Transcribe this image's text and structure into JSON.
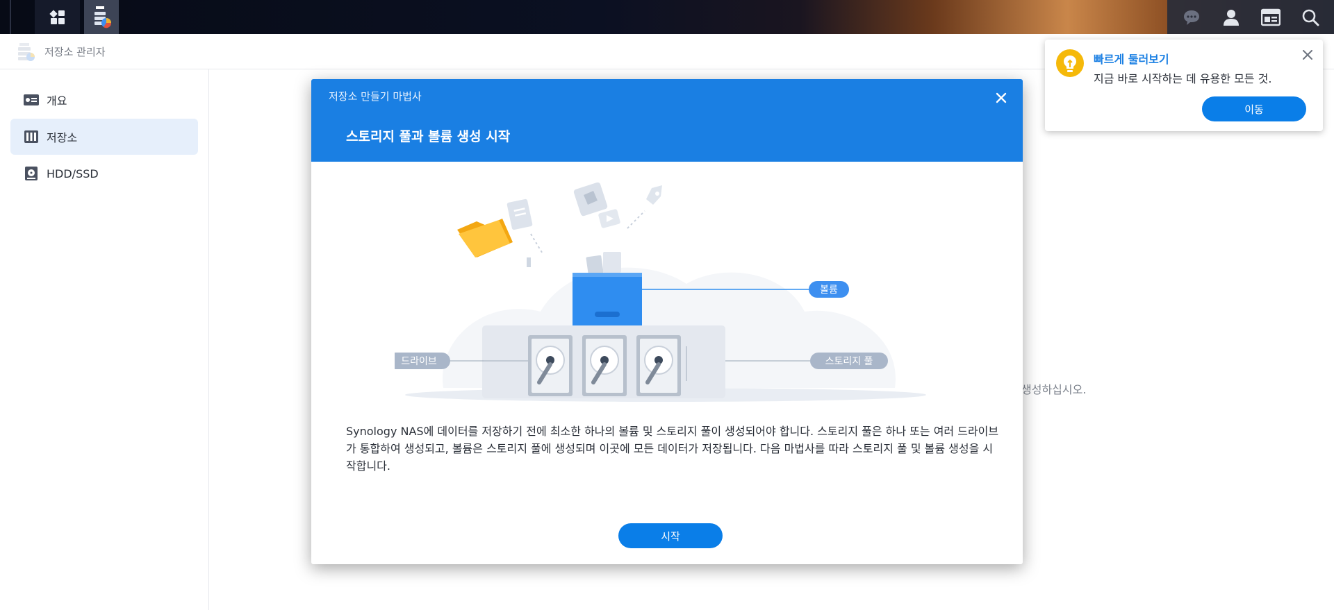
{
  "app": {
    "title": "저장소 관리자"
  },
  "sidebar": {
    "items": [
      {
        "label": "개요",
        "icon": "overview-icon",
        "active": false
      },
      {
        "label": "저장소",
        "icon": "storage-icon",
        "active": true
      },
      {
        "label": "HDD/SSD",
        "icon": "hdd-icon",
        "active": false
      }
    ]
  },
  "background": {
    "hint_text": "생성하십시오."
  },
  "wizard": {
    "subtitle": "저장소 만들기 마법사",
    "title": "스토리지 풀과 볼륨 생성 시작",
    "labels": {
      "volume": "볼륨",
      "drive": "드라이브",
      "pool": "스토리지 풀"
    },
    "description": "Synology NAS에 데이터를 저장하기 전에 최소한 하나의 볼륨 및 스토리지 풀이 생성되어야 합니다. 스토리지 풀은 하나 또는 여러 드라이브가 통합하여 생성되고, 볼륨은 스토리지 풀에 생성되며 이곳에 모든 데이터가 저장됩니다. 다음 마법사를 따라 스토리지 풀 및 볼륨 생성을 시작합니다.",
    "start_label": "시작"
  },
  "tour": {
    "title": "빠르게 둘러보기",
    "text": "지금 바로 시작하는 데 유용한 모든 것.",
    "go_label": "이동"
  },
  "colors": {
    "accent": "#1a7fe3",
    "button": "#0a7ee8",
    "tag": "#a9b6c9",
    "volume_tag": "#3d8ff0"
  }
}
